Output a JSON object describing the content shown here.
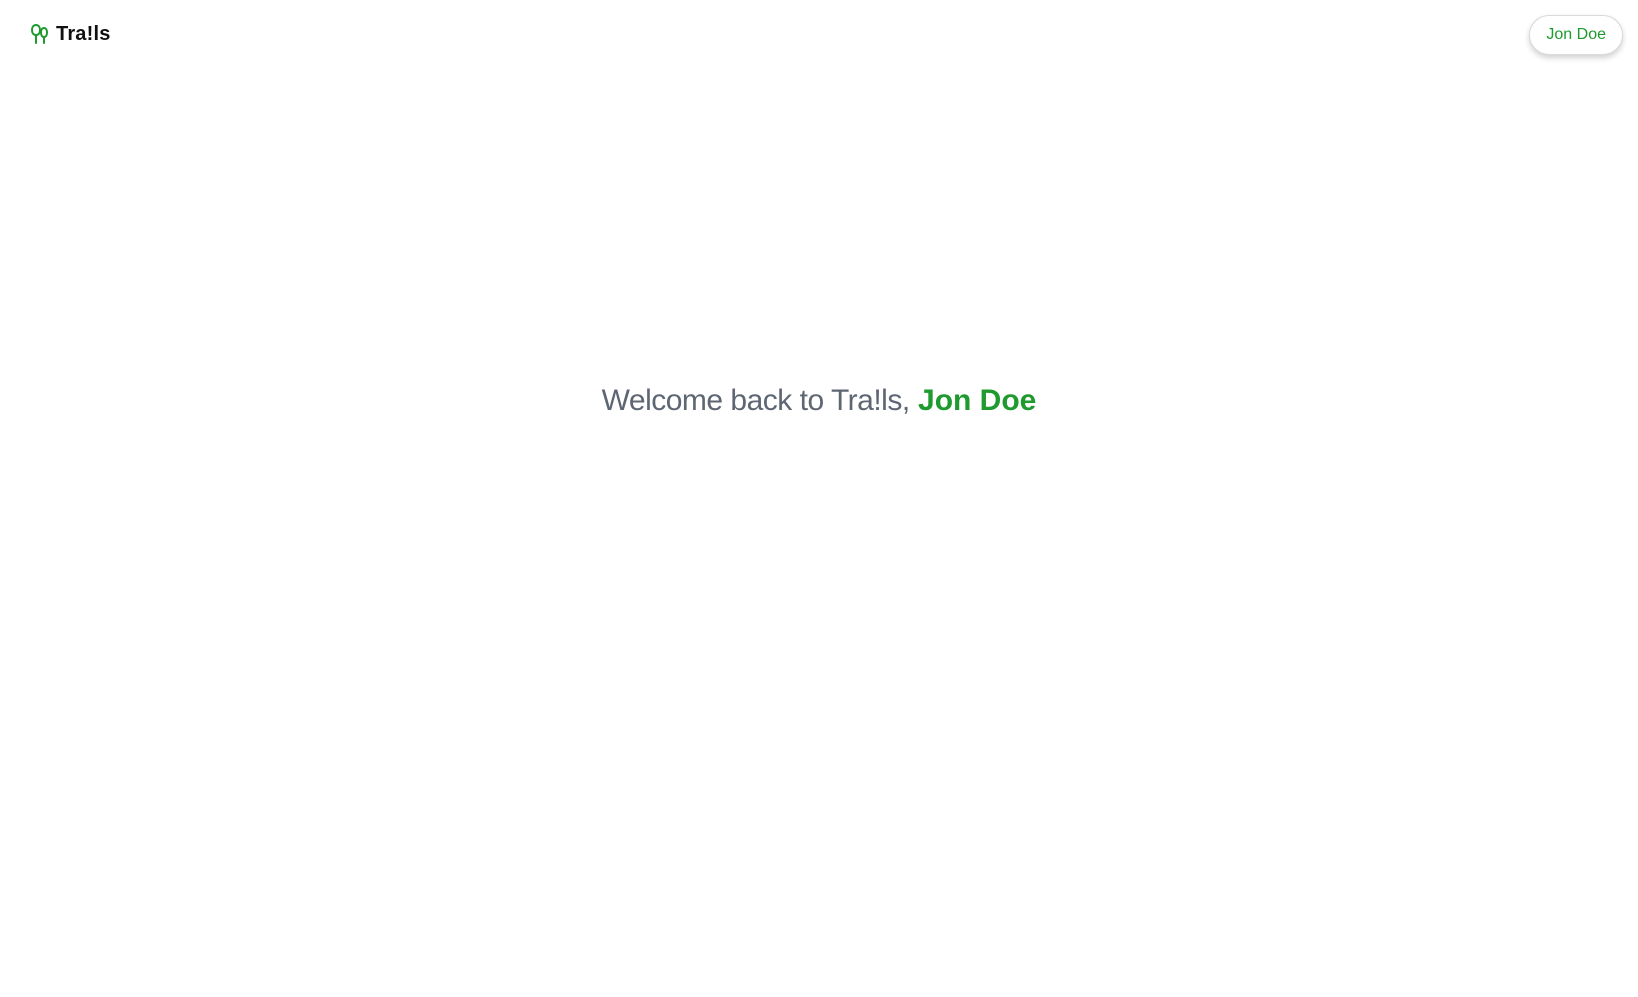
{
  "header": {
    "brand": {
      "name": "Tra!ls",
      "icon": "trees-icon"
    },
    "user_button_label": "Jon Doe"
  },
  "main": {
    "welcome_prefix": "Welcome back to Tra!ls,",
    "user_name": "Jon Doe"
  },
  "colors": {
    "accent": "#1e9a2e",
    "muted_text": "#5f6673",
    "brand_text": "#111111"
  }
}
